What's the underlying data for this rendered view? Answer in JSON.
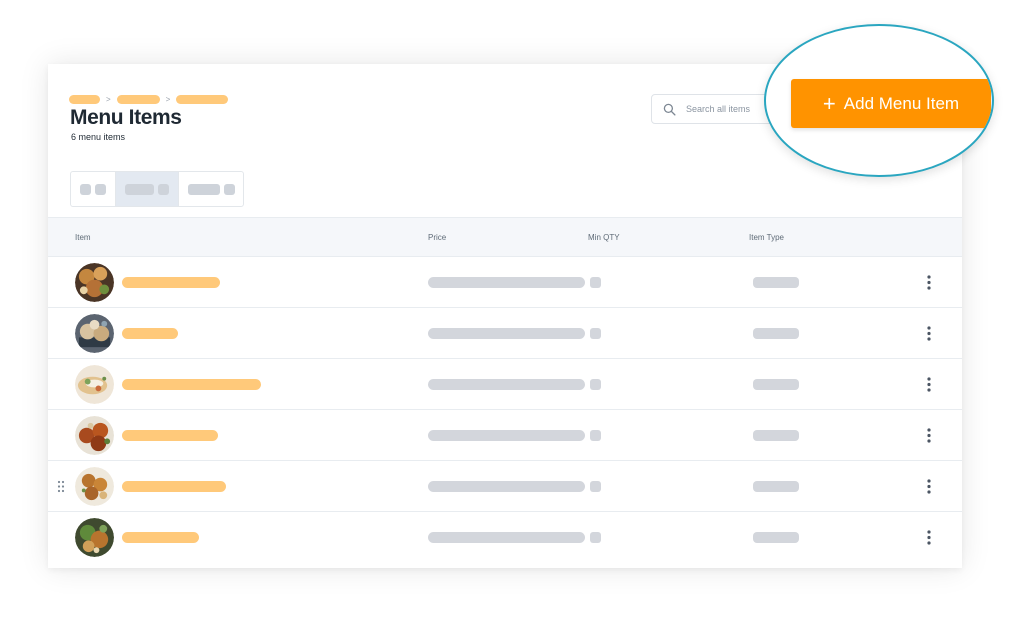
{
  "page": {
    "title": "Menu Items",
    "count_label": "6 menu items"
  },
  "search": {
    "placeholder": "Search all items"
  },
  "actions": {
    "add_label": "Add Menu Item",
    "add_icon": "plus-icon"
  },
  "table": {
    "columns": [
      "Item",
      "Price",
      "Min QTY",
      "Item Type"
    ],
    "rows": [
      {
        "thumb": "food-photo-1"
      },
      {
        "thumb": "food-photo-2"
      },
      {
        "thumb": "food-photo-3"
      },
      {
        "thumb": "food-photo-4"
      },
      {
        "thumb": "food-photo-5"
      },
      {
        "thumb": "food-photo-6"
      }
    ]
  },
  "colors": {
    "accent": "#ff9300",
    "highlight_ring": "#2aa6c0",
    "placeholder_orange": "#ffc97a",
    "placeholder_gray": "#d3d6dc"
  }
}
